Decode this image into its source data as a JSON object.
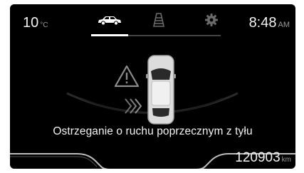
{
  "status": {
    "temperature": "10",
    "temperature_unit": "°C",
    "time": "8:48",
    "time_period": "AM"
  },
  "tabs": [
    {
      "icon": "car-icon",
      "active": true
    },
    {
      "icon": "lane-icon",
      "active": false
    },
    {
      "icon": "gear-icon",
      "active": false
    }
  ],
  "alert": {
    "message": "Ostrzeganie o ruchu poprzecznym z tyłu"
  },
  "odometer": {
    "value": "120903",
    "unit": "km"
  }
}
